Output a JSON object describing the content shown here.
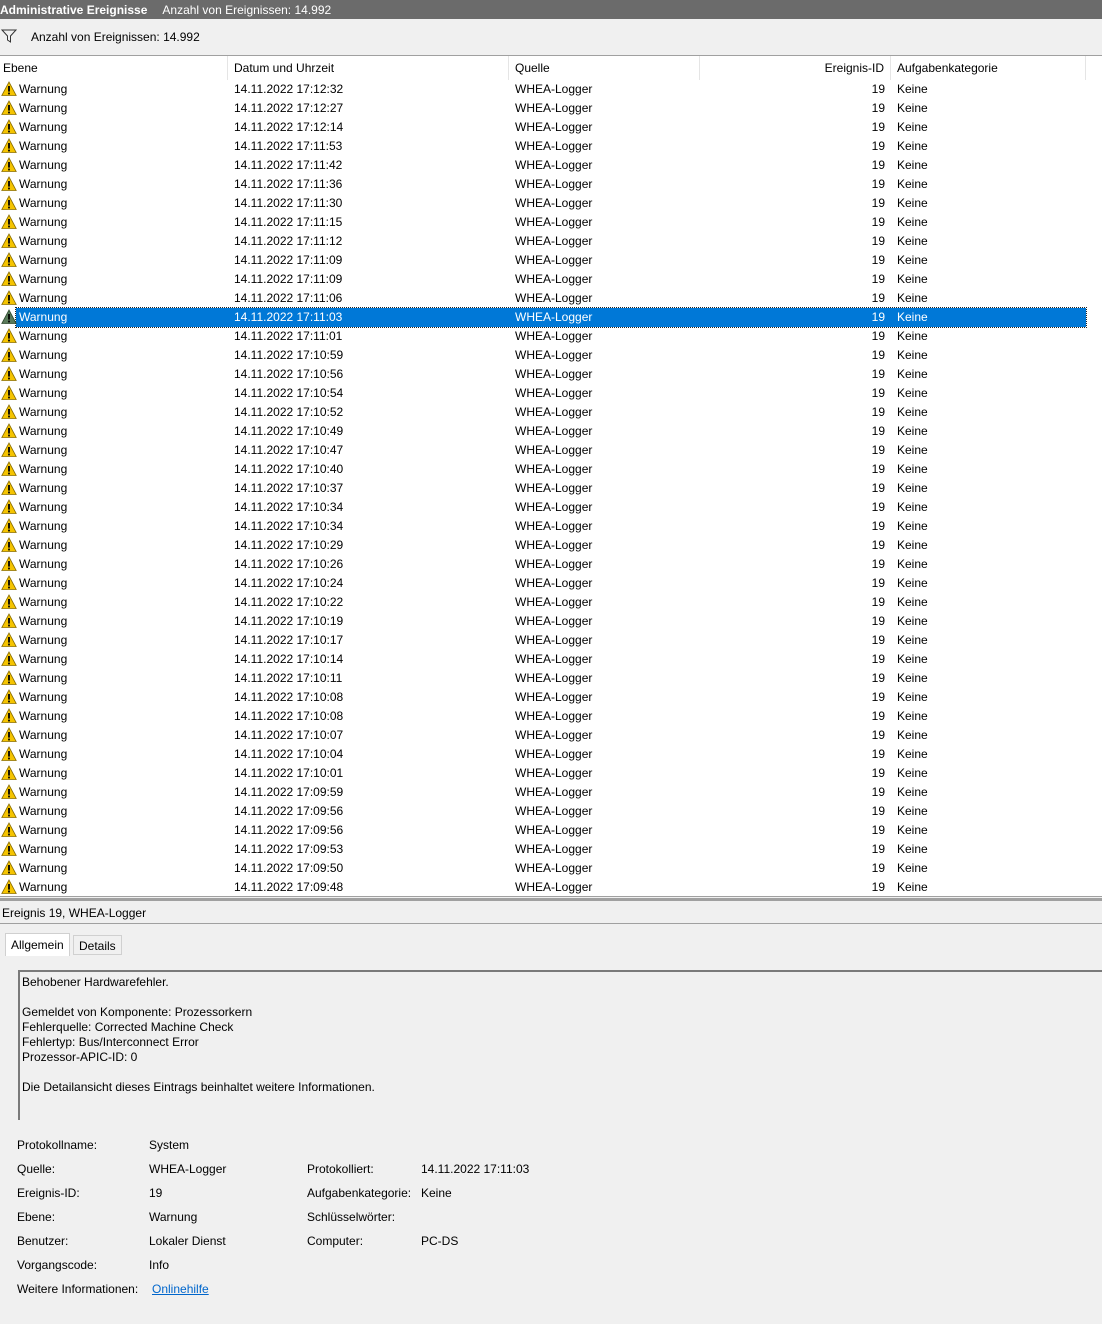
{
  "window": {
    "title": "Administrative Ereignisse",
    "count_label": "Anzahl von Ereignissen: 14.992"
  },
  "filter_bar": {
    "count_label": "Anzahl von Ereignissen: 14.992"
  },
  "columns": [
    "Ebene",
    "Datum und Uhrzeit",
    "Quelle",
    "Ereignis-ID",
    "Aufgabenkategorie"
  ],
  "selected_index": 12,
  "rows": [
    {
      "level": "Warnung",
      "datetime": "14.11.2022 17:12:32",
      "source": "WHEA-Logger",
      "id": "19",
      "category": "Keine"
    },
    {
      "level": "Warnung",
      "datetime": "14.11.2022 17:12:27",
      "source": "WHEA-Logger",
      "id": "19",
      "category": "Keine"
    },
    {
      "level": "Warnung",
      "datetime": "14.11.2022 17:12:14",
      "source": "WHEA-Logger",
      "id": "19",
      "category": "Keine"
    },
    {
      "level": "Warnung",
      "datetime": "14.11.2022 17:11:53",
      "source": "WHEA-Logger",
      "id": "19",
      "category": "Keine"
    },
    {
      "level": "Warnung",
      "datetime": "14.11.2022 17:11:42",
      "source": "WHEA-Logger",
      "id": "19",
      "category": "Keine"
    },
    {
      "level": "Warnung",
      "datetime": "14.11.2022 17:11:36",
      "source": "WHEA-Logger",
      "id": "19",
      "category": "Keine"
    },
    {
      "level": "Warnung",
      "datetime": "14.11.2022 17:11:30",
      "source": "WHEA-Logger",
      "id": "19",
      "category": "Keine"
    },
    {
      "level": "Warnung",
      "datetime": "14.11.2022 17:11:15",
      "source": "WHEA-Logger",
      "id": "19",
      "category": "Keine"
    },
    {
      "level": "Warnung",
      "datetime": "14.11.2022 17:11:12",
      "source": "WHEA-Logger",
      "id": "19",
      "category": "Keine"
    },
    {
      "level": "Warnung",
      "datetime": "14.11.2022 17:11:09",
      "source": "WHEA-Logger",
      "id": "19",
      "category": "Keine"
    },
    {
      "level": "Warnung",
      "datetime": "14.11.2022 17:11:09",
      "source": "WHEA-Logger",
      "id": "19",
      "category": "Keine"
    },
    {
      "level": "Warnung",
      "datetime": "14.11.2022 17:11:06",
      "source": "WHEA-Logger",
      "id": "19",
      "category": "Keine"
    },
    {
      "level": "Warnung",
      "datetime": "14.11.2022 17:11:03",
      "source": "WHEA-Logger",
      "id": "19",
      "category": "Keine"
    },
    {
      "level": "Warnung",
      "datetime": "14.11.2022 17:11:01",
      "source": "WHEA-Logger",
      "id": "19",
      "category": "Keine"
    },
    {
      "level": "Warnung",
      "datetime": "14.11.2022 17:10:59",
      "source": "WHEA-Logger",
      "id": "19",
      "category": "Keine"
    },
    {
      "level": "Warnung",
      "datetime": "14.11.2022 17:10:56",
      "source": "WHEA-Logger",
      "id": "19",
      "category": "Keine"
    },
    {
      "level": "Warnung",
      "datetime": "14.11.2022 17:10:54",
      "source": "WHEA-Logger",
      "id": "19",
      "category": "Keine"
    },
    {
      "level": "Warnung",
      "datetime": "14.11.2022 17:10:52",
      "source": "WHEA-Logger",
      "id": "19",
      "category": "Keine"
    },
    {
      "level": "Warnung",
      "datetime": "14.11.2022 17:10:49",
      "source": "WHEA-Logger",
      "id": "19",
      "category": "Keine"
    },
    {
      "level": "Warnung",
      "datetime": "14.11.2022 17:10:47",
      "source": "WHEA-Logger",
      "id": "19",
      "category": "Keine"
    },
    {
      "level": "Warnung",
      "datetime": "14.11.2022 17:10:40",
      "source": "WHEA-Logger",
      "id": "19",
      "category": "Keine"
    },
    {
      "level": "Warnung",
      "datetime": "14.11.2022 17:10:37",
      "source": "WHEA-Logger",
      "id": "19",
      "category": "Keine"
    },
    {
      "level": "Warnung",
      "datetime": "14.11.2022 17:10:34",
      "source": "WHEA-Logger",
      "id": "19",
      "category": "Keine"
    },
    {
      "level": "Warnung",
      "datetime": "14.11.2022 17:10:34",
      "source": "WHEA-Logger",
      "id": "19",
      "category": "Keine"
    },
    {
      "level": "Warnung",
      "datetime": "14.11.2022 17:10:29",
      "source": "WHEA-Logger",
      "id": "19",
      "category": "Keine"
    },
    {
      "level": "Warnung",
      "datetime": "14.11.2022 17:10:26",
      "source": "WHEA-Logger",
      "id": "19",
      "category": "Keine"
    },
    {
      "level": "Warnung",
      "datetime": "14.11.2022 17:10:24",
      "source": "WHEA-Logger",
      "id": "19",
      "category": "Keine"
    },
    {
      "level": "Warnung",
      "datetime": "14.11.2022 17:10:22",
      "source": "WHEA-Logger",
      "id": "19",
      "category": "Keine"
    },
    {
      "level": "Warnung",
      "datetime": "14.11.2022 17:10:19",
      "source": "WHEA-Logger",
      "id": "19",
      "category": "Keine"
    },
    {
      "level": "Warnung",
      "datetime": "14.11.2022 17:10:17",
      "source": "WHEA-Logger",
      "id": "19",
      "category": "Keine"
    },
    {
      "level": "Warnung",
      "datetime": "14.11.2022 17:10:14",
      "source": "WHEA-Logger",
      "id": "19",
      "category": "Keine"
    },
    {
      "level": "Warnung",
      "datetime": "14.11.2022 17:10:11",
      "source": "WHEA-Logger",
      "id": "19",
      "category": "Keine"
    },
    {
      "level": "Warnung",
      "datetime": "14.11.2022 17:10:08",
      "source": "WHEA-Logger",
      "id": "19",
      "category": "Keine"
    },
    {
      "level": "Warnung",
      "datetime": "14.11.2022 17:10:08",
      "source": "WHEA-Logger",
      "id": "19",
      "category": "Keine"
    },
    {
      "level": "Warnung",
      "datetime": "14.11.2022 17:10:07",
      "source": "WHEA-Logger",
      "id": "19",
      "category": "Keine"
    },
    {
      "level": "Warnung",
      "datetime": "14.11.2022 17:10:04",
      "source": "WHEA-Logger",
      "id": "19",
      "category": "Keine"
    },
    {
      "level": "Warnung",
      "datetime": "14.11.2022 17:10:01",
      "source": "WHEA-Logger",
      "id": "19",
      "category": "Keine"
    },
    {
      "level": "Warnung",
      "datetime": "14.11.2022 17:09:59",
      "source": "WHEA-Logger",
      "id": "19",
      "category": "Keine"
    },
    {
      "level": "Warnung",
      "datetime": "14.11.2022 17:09:56",
      "source": "WHEA-Logger",
      "id": "19",
      "category": "Keine"
    },
    {
      "level": "Warnung",
      "datetime": "14.11.2022 17:09:56",
      "source": "WHEA-Logger",
      "id": "19",
      "category": "Keine"
    },
    {
      "level": "Warnung",
      "datetime": "14.11.2022 17:09:53",
      "source": "WHEA-Logger",
      "id": "19",
      "category": "Keine"
    },
    {
      "level": "Warnung",
      "datetime": "14.11.2022 17:09:50",
      "source": "WHEA-Logger",
      "id": "19",
      "category": "Keine"
    },
    {
      "level": "Warnung",
      "datetime": "14.11.2022 17:09:48",
      "source": "WHEA-Logger",
      "id": "19",
      "category": "Keine"
    }
  ],
  "detail": {
    "title": "Ereignis 19, WHEA-Logger",
    "tabs": [
      "Allgemein",
      "Details"
    ],
    "description": [
      "Behobener Hardwarefehler.",
      "",
      "Gemeldet von Komponente: Prozessorkern",
      "Fehlerquelle: Corrected Machine Check",
      "Fehlertyp: Bus/Interconnect Error",
      "Prozessor-APIC-ID: 0",
      "",
      "Die Detailansicht dieses Eintrags beinhaltet weitere Informationen."
    ],
    "props": {
      "log_name_label": "Protokollname:",
      "log_name": "System",
      "source_label": "Quelle:",
      "source": "WHEA-Logger",
      "logged_label": "Protokolliert:",
      "logged": "14.11.2022 17:11:03",
      "event_id_label": "Ereignis-ID:",
      "event_id": "19",
      "task_cat_label": "Aufgabenkategorie:",
      "task_cat": "Keine",
      "level_label": "Ebene:",
      "level": "Warnung",
      "keywords_label": "Schlüsselwörter:",
      "keywords": "",
      "user_label": "Benutzer:",
      "user": "Lokaler Dienst",
      "computer_label": "Computer:",
      "computer": "PC-DS",
      "opcode_label": "Vorgangscode:",
      "opcode": "Info",
      "more_info_label": "Weitere Informationen:",
      "more_info_link": "Onlinehilfe"
    }
  },
  "colors": {
    "selection": "#0078d7",
    "titlebar": "#6b6b6b",
    "link": "#0066cc"
  },
  "icons": {
    "level": "warning-icon",
    "filter": "filter-icon"
  }
}
